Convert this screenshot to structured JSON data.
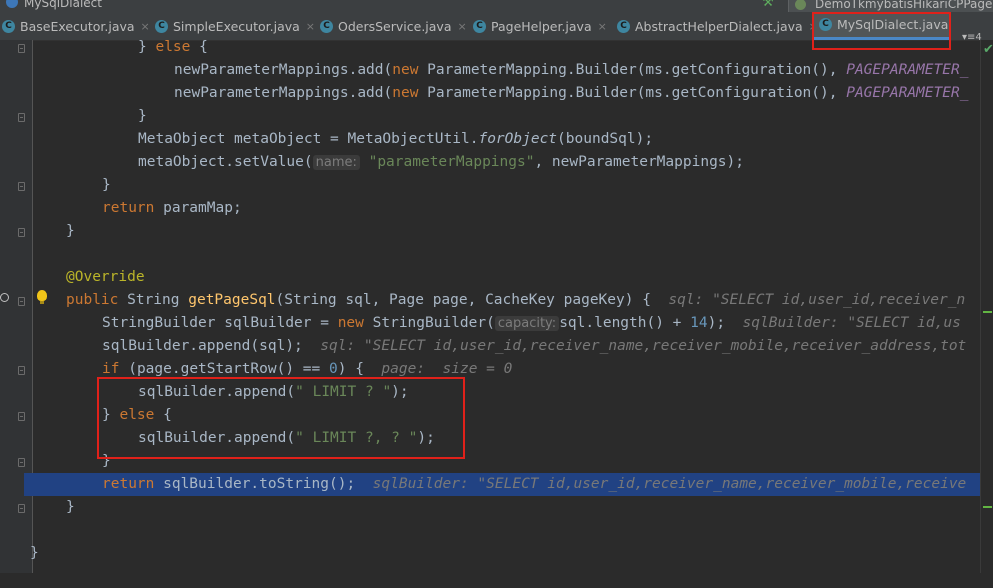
{
  "window": {
    "file_title": "MySqlDialect",
    "run_config": "DemoTkmybatisHikariCPPageH"
  },
  "tabs": [
    {
      "label": "BaseExecutor.java",
      "active": false
    },
    {
      "label": "SimpleExecutor.java",
      "active": false
    },
    {
      "label": "OdersService.java",
      "active": false
    },
    {
      "label": "PageHelper.java",
      "active": false
    },
    {
      "label": "AbstractHelperDialect.java",
      "active": false
    },
    {
      "label": "MySqlDialect.java",
      "active": true
    }
  ],
  "tab_icon_letter": "C",
  "tab_close_glyph": "×",
  "tabs_overflow": "▾≡4",
  "colors": {
    "background": "#2b2b2b",
    "keyword": "#cc7832",
    "string": "#6a8759",
    "number": "#6897bb",
    "annotation": "#bbb529",
    "method_decl": "#ffc66d",
    "constant": "#9876aa",
    "selection": "#214283",
    "highlight_box": "#e0211a"
  },
  "icons": {
    "gutter": [
      "override-icon",
      "lightbulb-icon"
    ],
    "tabs": "class-icon",
    "status": "check-icon"
  },
  "code": {
    "l1_brace": "} ",
    "l1_else": "else",
    "l1_open": " {",
    "l2_target": "newParameterMappings.add(",
    "l2_new": "new",
    "l2_builder": " ParameterMapping.Builder(ms.getConfiguration(), ",
    "l2_const": "PAGEPARAMETER_",
    "l3_target": "newParameterMappings.add(",
    "l3_new": "new",
    "l3_builder": " ParameterMapping.Builder(ms.getConfiguration(), ",
    "l3_const": "PAGEPARAMETER_",
    "l4_close": "}",
    "l5_a": "MetaObject metaObject = MetaObjectUtil.",
    "l5_method": "forObject",
    "l5_b": "(boundSql);",
    "l6_a": "metaObject.setValue(",
    "l6_hint": "name:",
    "l6_str": "\"parameterMappings\"",
    "l6_b": ", newParameterMappings);",
    "l7_close": "}",
    "l8_return": "return",
    "l8_rest": " paramMap;",
    "l9_close": "}",
    "l11_annotation": "@Override",
    "l12_public": "public",
    "l12_type": " String ",
    "l12_name": "getPageSql",
    "l12_params_a": "(String sql, Page ",
    "l12_page": "page",
    "l12_params_b": ", CacheKey pageKey) {",
    "l12_debug_name": "sql:",
    "l12_debug_val": "\"SELECT id,user_id,receiver_n",
    "l13_a": "StringBuilder sqlBuilder = ",
    "l13_new": "new",
    "l13_b": " StringBuilder(",
    "l13_hint": "capacity:",
    "l13_c": "sql.length() + ",
    "l13_num": "14",
    "l13_d": ");",
    "l13_debug_name": "sqlBuilder:",
    "l13_debug_val": "\"SELECT id,us",
    "l14_a": "sqlBuilder.append(sql);",
    "l14_debug_name": "sql:",
    "l14_debug_val": "\"SELECT id,user_id,receiver_name,receiver_mobile,receiver_address,tot",
    "l15_if": "if",
    "l15_a": " (",
    "l15_page": "page",
    "l15_b": ".getStartRow() == ",
    "l15_num": "0",
    "l15_c": ") {",
    "l15_debug_name": "page:",
    "l15_debug_val": "size = 0",
    "l16_a": "sqlBuilder.append(",
    "l16_str": "\" LIMIT ? \"",
    "l16_b": ");",
    "l17_brace": "} ",
    "l17_else": "else",
    "l17_open": " {",
    "l18_a": "sqlBuilder.append(",
    "l18_str": "\" LIMIT ?, ? \"",
    "l18_b": ");",
    "l19_close": "}",
    "l20_return": "return",
    "l20_rest": " sqlBuilder.toString();",
    "l20_debug_name": "sqlBuilder:",
    "l20_debug_val": "\"SELECT id,user_id,receiver_name,receiver_mobile,receive",
    "l21_close": "}",
    "l23_close": "}"
  }
}
